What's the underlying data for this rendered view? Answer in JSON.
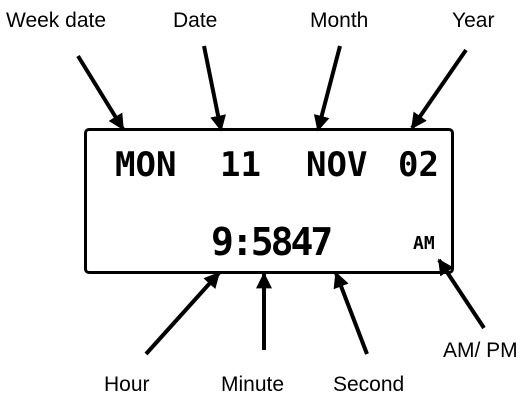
{
  "labels": {
    "week_date": "Week date",
    "date": "Date",
    "month": "Month",
    "year": "Year",
    "hour": "Hour",
    "minute": "Minute",
    "second": "Second",
    "ampm": "AM/ PM"
  },
  "display": {
    "weekday": "MON",
    "day": "11",
    "month": "NOV",
    "year": "02",
    "time": "9:5847",
    "meridiem": "AM"
  }
}
